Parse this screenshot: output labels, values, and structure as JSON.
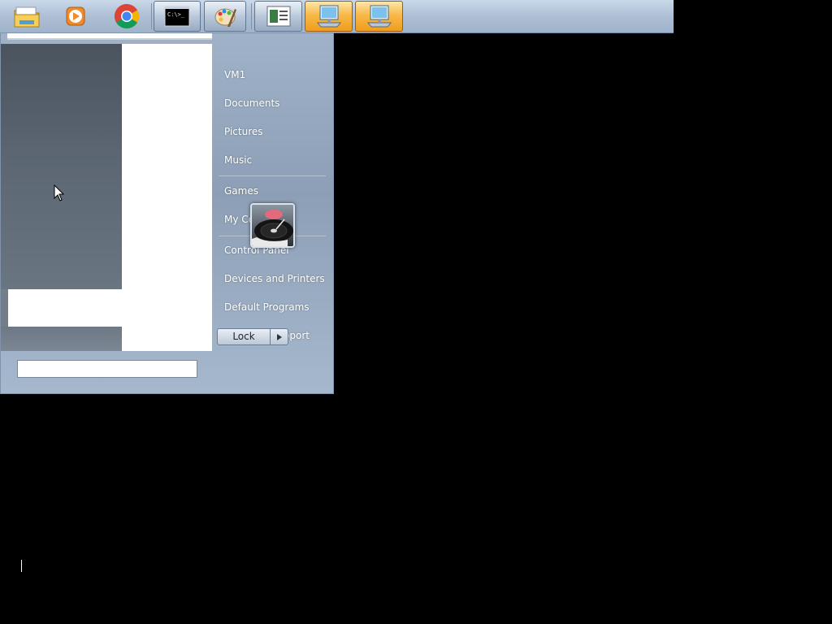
{
  "taskbar": {
    "pinned": [
      {
        "name": "file-explorer-icon"
      },
      {
        "name": "media-player-icon"
      },
      {
        "name": "chrome-icon"
      },
      {
        "name": "command-prompt-icon",
        "label": "C:\\>_"
      },
      {
        "name": "paint-icon"
      },
      {
        "name": "document-viewer-icon"
      },
      {
        "name": "remote-desktop-icon"
      },
      {
        "name": "remote-desktop-icon-2"
      }
    ]
  },
  "start_menu": {
    "right_items": {
      "user": "VM1",
      "documents": "Documents",
      "pictures": "Pictures",
      "music": "Music",
      "games": "Games",
      "computer": "My Co",
      "control_panel": "Control Panel",
      "devices": "Devices and Printers",
      "default_programs": "Default Programs",
      "help": "Help and Support"
    },
    "search_value": "",
    "lock_label": "Lock"
  },
  "colors": {
    "taskbar": "#aebfd4",
    "menu_bg": "#9fb2c8",
    "active_button": "#f8b94a",
    "desktop": "#000000"
  }
}
